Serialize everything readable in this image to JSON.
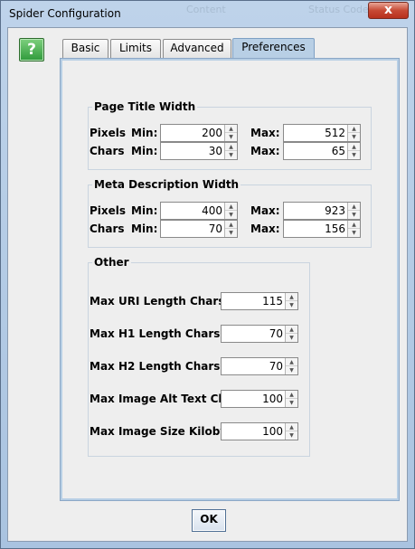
{
  "window": {
    "title": "Spider Configuration",
    "background_tab_text_1": "Content",
    "background_tab_text_2": "Status Code",
    "close_glyph": "x"
  },
  "help": {
    "label": "?"
  },
  "tabs": [
    {
      "label": "Basic",
      "active": false
    },
    {
      "label": "Limits",
      "active": false
    },
    {
      "label": "Advanced",
      "active": false
    },
    {
      "label": "Preferences",
      "active": true
    }
  ],
  "page_title_width": {
    "legend": "Page Title Width",
    "pixels_label": "Pixels",
    "chars_label": "Chars",
    "min_label": "Min:",
    "max_label": "Max:",
    "pixels_min": "200",
    "pixels_max": "512",
    "chars_min": "30",
    "chars_max": "65"
  },
  "meta_description_width": {
    "legend": "Meta Description Width",
    "pixels_label": "Pixels",
    "chars_label": "Chars",
    "min_label": "Min:",
    "max_label": "Max:",
    "pixels_min": "400",
    "pixels_max": "923",
    "chars_min": "70",
    "chars_max": "156"
  },
  "other": {
    "legend": "Other",
    "rows": [
      {
        "label": "Max URI Length Chars",
        "value": "115"
      },
      {
        "label": "Max H1 Length Chars",
        "value": "70"
      },
      {
        "label": "Max H2 Length Chars",
        "value": "70"
      },
      {
        "label": "Max Image Alt Text Chars",
        "value": "100"
      },
      {
        "label": "Max Image Size Kilobytes",
        "value": "100"
      }
    ]
  },
  "footer": {
    "ok_label": "OK"
  },
  "colors": {
    "title_bar": "#bed3ea",
    "active_tab": "#b8cfe5",
    "close_button": "#c74a35",
    "help_button": "#2f9a3b"
  }
}
